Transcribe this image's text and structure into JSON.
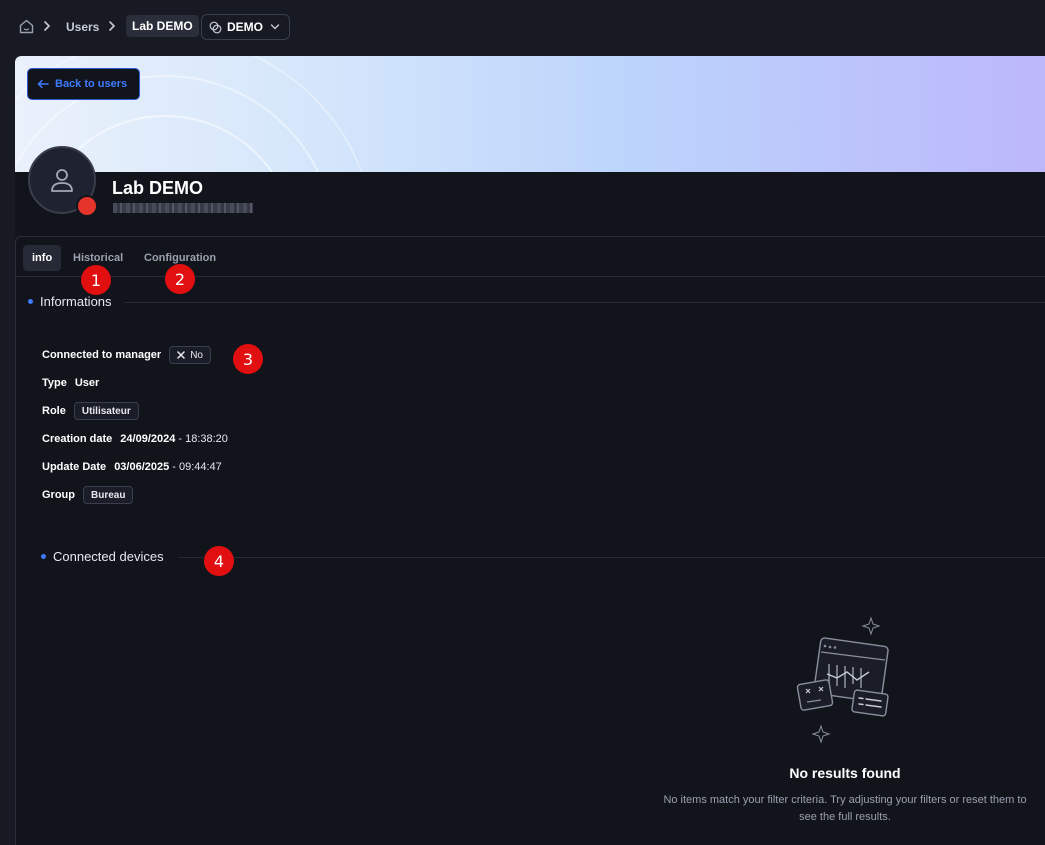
{
  "breadcrumb": {
    "home_icon": "home-icon",
    "users": "Users",
    "current": "Lab DEMO",
    "org_select": {
      "value": "DEMO",
      "icon": "link-circles-icon"
    }
  },
  "header": {
    "back_label": "Back to users",
    "user_name": "Lab DEMO",
    "status_color": "#e5342b"
  },
  "tabs": [
    {
      "label": "info",
      "active": true
    },
    {
      "label": "Historical",
      "active": false
    },
    {
      "label": "Configuration",
      "active": false
    }
  ],
  "markers": [
    "1",
    "2",
    "3",
    "4"
  ],
  "informations": {
    "title": "Informations",
    "connected_to_manager": {
      "label": "Connected to manager",
      "value": "No"
    },
    "type": {
      "label": "Type",
      "value": "User"
    },
    "role": {
      "label": "Role",
      "value": "Utilisateur"
    },
    "creation_date": {
      "label": "Creation date",
      "date": "24/09/2024",
      "time": " - 18:38:20"
    },
    "update_date": {
      "label": "Update Date",
      "date": "03/06/2025",
      "time": " - 09:44:47"
    },
    "group": {
      "label": "Group",
      "value": "Bureau"
    }
  },
  "devices": {
    "title": "Connected devices",
    "empty_title": "No results found",
    "empty_text": "No items match your filter criteria. Try adjusting your filters or reset them to see the full results."
  },
  "colors": {
    "accent": "#3f7bff",
    "marker": "#e20f10",
    "background": "#12141c"
  }
}
